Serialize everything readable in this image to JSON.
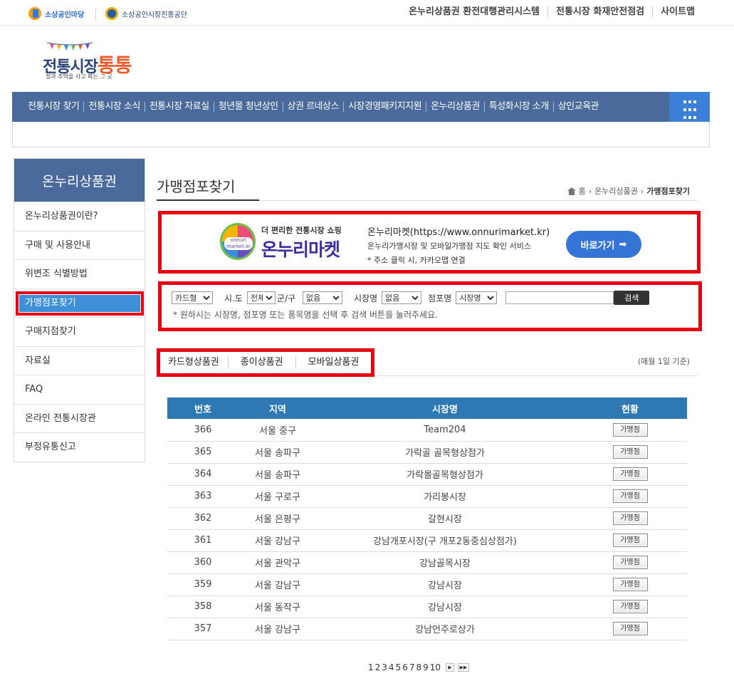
{
  "topbar": {
    "logo1": "소상공인마당",
    "logo2": "소상공인시장진흥공단",
    "links": [
      "온누리상품권 환전대행관리시스템",
      "전통시장 화재안전점검",
      "사이트맵"
    ]
  },
  "brand": {
    "name_prefix": "전통시장",
    "name_suffix": "통통",
    "slogan": "정과 추억을 사고 파는 그 곳"
  },
  "gnb": {
    "items": [
      "전통시장 찾기",
      "전통시장 소식",
      "전통시장 자료실",
      "청년몰 청년상인",
      "상권 르네상스",
      "시장경영패키지지원",
      "온누리상품권",
      "특성화시장 소개",
      "상인교육관"
    ]
  },
  "lnb": {
    "title": "온누리상품권",
    "items": [
      "온누리상품권이란?",
      "구매 및 사용안내",
      "위변조 식별방법",
      "가맹점포찾기",
      "구매지점찾기",
      "자료실",
      "FAQ",
      "온라인 전통시장관",
      "부정유통신고"
    ],
    "active_index": 3
  },
  "page": {
    "title": "가맹점포찾기",
    "breadcrumb": {
      "home": "홈",
      "parent": "온누리상품권",
      "current": "가맹점포찾기"
    }
  },
  "banner": {
    "slogan": "더 편리한 전통시장 쇼핑",
    "name": "온누리마켓",
    "logo_text": "onnuri market.kr",
    "info1": "온누리마켓(https://www.onnurimarket.kr)",
    "info2": "온누리가맹시장 및 모바일가맹점 지도 확인 서비스",
    "info3": "* 주소 클릭 시, 카카오맵 연결",
    "go_label": "바로가기"
  },
  "search": {
    "type_value": "카드형",
    "sido_label": "시.도",
    "sido_value": "전체",
    "gungu_label": "군/구",
    "gungu_value": "없음",
    "market_label": "시장명",
    "market_value": "없음",
    "store_label": "점포명",
    "store_select_value": "시장명",
    "keyword_value": "",
    "button_label": "검색",
    "note": "* 원하시는 시장명, 점포명 또는 품목명을 선택 후 검색 버튼을 눌러주세요."
  },
  "tabs": [
    "카드형상품권",
    "종이상품권",
    "모바일상품권"
  ],
  "basis_note": "(매월 1일 기준)",
  "table": {
    "headers": [
      "번호",
      "지역",
      "시장명",
      "현황"
    ],
    "status_label": "가맹점",
    "rows": [
      {
        "no": "366",
        "region": "서울 중구",
        "market": "Team204"
      },
      {
        "no": "365",
        "region": "서울 송파구",
        "market": "가락골 골목형상점가"
      },
      {
        "no": "364",
        "region": "서울 송파구",
        "market": "가락몰골목형상점가"
      },
      {
        "no": "363",
        "region": "서울 구로구",
        "market": "가리봉시장"
      },
      {
        "no": "362",
        "region": "서울 은평구",
        "market": "갈현시장"
      },
      {
        "no": "361",
        "region": "서울 강남구",
        "market": "강남개포시장(구 개포2동중심상점가)"
      },
      {
        "no": "360",
        "region": "서울 관악구",
        "market": "강남골목시장"
      },
      {
        "no": "359",
        "region": "서울 강남구",
        "market": "강남시장"
      },
      {
        "no": "358",
        "region": "서울 동작구",
        "market": "강남시장"
      },
      {
        "no": "357",
        "region": "서울 강남구",
        "market": "강남언주로상가"
      }
    ]
  },
  "paging": {
    "pages": [
      "1",
      "2",
      "3",
      "4",
      "5",
      "6",
      "7",
      "8",
      "9",
      "10"
    ],
    "next_icon": "next-page-icon",
    "last_icon": "last-page-icon"
  },
  "colors": {
    "nav": "#4a6a9c",
    "accent_blue": "#3474d4",
    "table_header": "#2e79b4",
    "highlight_red": "#e60012"
  }
}
